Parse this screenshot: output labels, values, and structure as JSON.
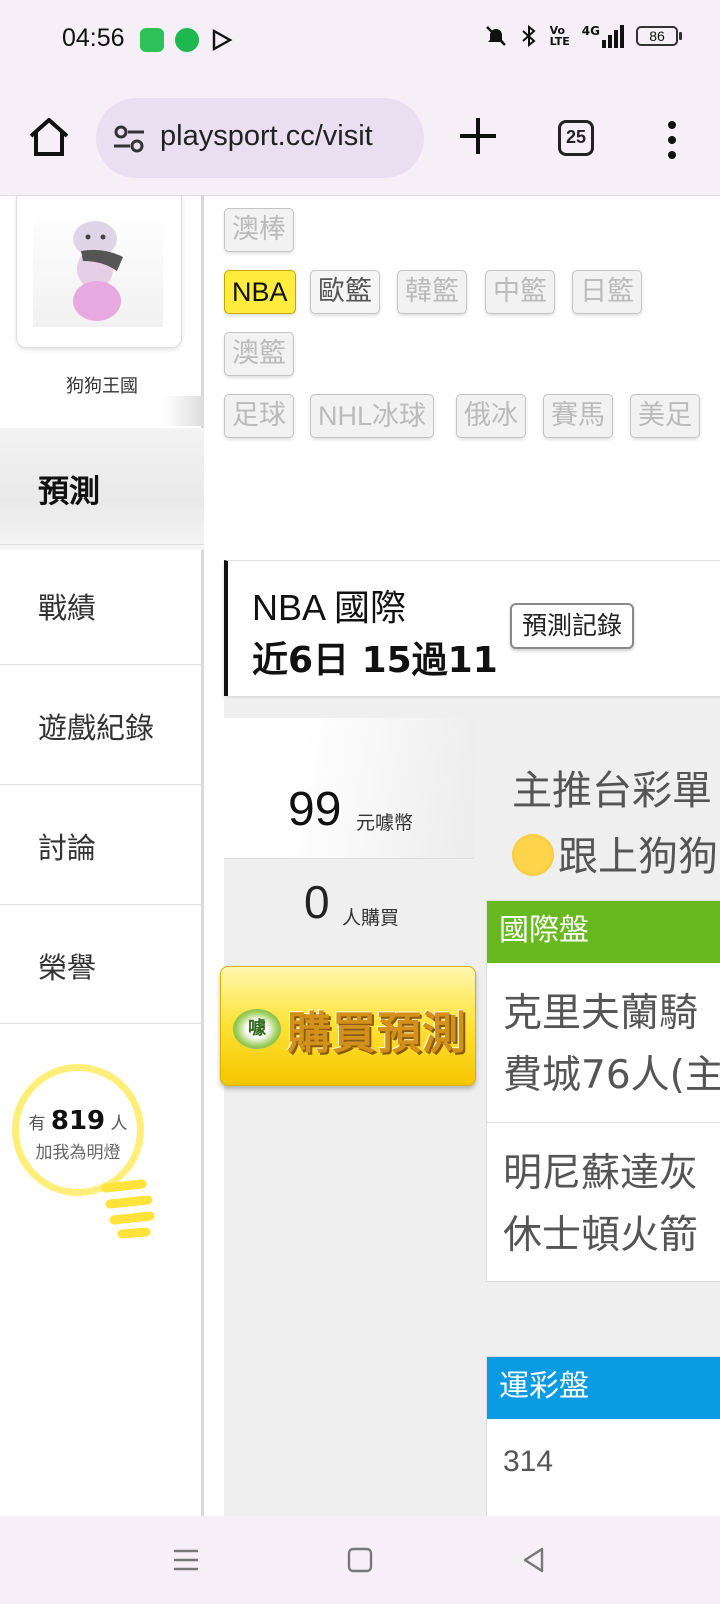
{
  "status_bar": {
    "time": "04:56",
    "network": "4G",
    "battery": "86",
    "app_icons": [
      "wechat-icon",
      "upload-icon",
      "play-store-icon"
    ],
    "system_icons": [
      "mute-icon",
      "bluetooth-icon",
      "volte-icon",
      "signal-icon",
      "battery-icon"
    ]
  },
  "browser": {
    "url": "playsport.cc/visit",
    "tab_count": "25"
  },
  "profile": {
    "user_name": "狗狗王國"
  },
  "left_nav": {
    "items": [
      {
        "label": "預測",
        "active": true
      },
      {
        "label": "戰績"
      },
      {
        "label": "遊戲紀錄"
      },
      {
        "label": "討論"
      },
      {
        "label": "榮譽"
      }
    ]
  },
  "fans": {
    "prefix": "有",
    "count": "819",
    "suffix": "人",
    "caption": "加我為明燈"
  },
  "league_tags": {
    "row0": [
      "澳棒"
    ],
    "row1": [
      "NBA",
      "歐籃",
      "韓籃",
      "中籃",
      "日籃"
    ],
    "row2": [
      "澳籃"
    ],
    "row3": [
      "足球",
      "NHL冰球",
      "俄冰",
      "賽馬",
      "美足"
    ],
    "active": "NBA"
  },
  "prediction_card": {
    "league": "NBA 國際",
    "record": "近6日 15過11",
    "record_button": "預測記錄"
  },
  "purchase": {
    "price": "99",
    "price_unit": "元噱幣",
    "buyers": "0",
    "buyers_unit": "人購買",
    "buy_button": "購買預測",
    "coin_label": "噱"
  },
  "promo": {
    "line1": "主推台彩單",
    "line2": "跟上狗狗"
  },
  "markets": {
    "international": {
      "title": "國際盤",
      "color": "#68b91f",
      "games": [
        {
          "line1": "克里夫蘭騎",
          "line2": "費城76人(主"
        },
        {
          "line1": "明尼蘇達灰",
          "line2": "休士頓火箭"
        }
      ]
    },
    "sports_lottery": {
      "title": "運彩盤",
      "color": "#0b9be3",
      "first_code": "314"
    }
  },
  "colors": {
    "chrome_bg": "#f7eff8",
    "active_tag": "#ffec3d",
    "buy_button": "#ffe233"
  }
}
